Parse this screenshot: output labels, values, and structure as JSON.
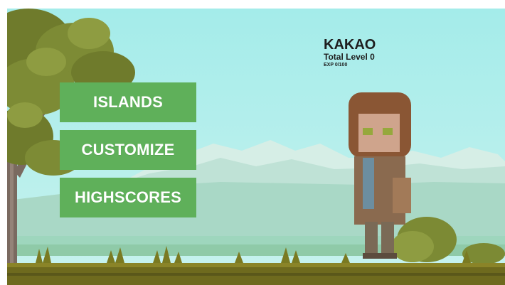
{
  "player": {
    "name": "KAKAO",
    "total_level": "Total Level 0",
    "exp": "EXP 0/100"
  },
  "menu": {
    "islands": "ISLANDS",
    "customize": "CUSTOMIZE",
    "highscores": "HIGHSCORES"
  },
  "colors": {
    "sky": "#a8ecec",
    "button": "#5fb05a",
    "button_text": "#ffffff",
    "ground": "#6e6a1e"
  },
  "icons": [
    "pixel-tree",
    "pixel-character",
    "pixel-bush",
    "grass-tufts",
    "distant-mountains"
  ]
}
